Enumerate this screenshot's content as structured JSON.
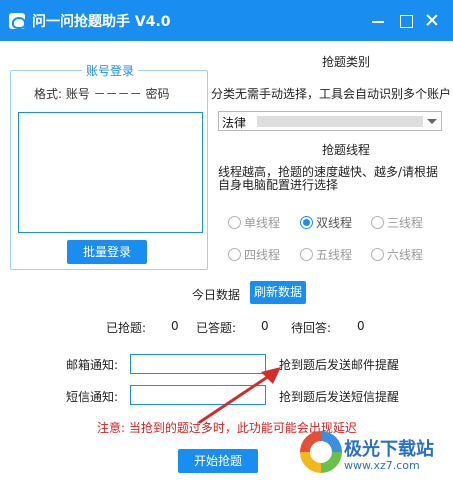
{
  "window": {
    "title": "问一问抢题助手 V4.0",
    "icon": "app-icon"
  },
  "account": {
    "group_title": "账号登录",
    "format_label": "格式: 账号 －－－－ 密码",
    "textarea_value": "",
    "batch_login_label": "批量登录"
  },
  "category": {
    "title": "抢题类别",
    "description": "分类无需手动选择，工具会自动识别多个账户",
    "selected": "法律"
  },
  "threads": {
    "title": "抢题线程",
    "description": "线程越高，抢题的速度越快、越多/请根据自身电脑配置进行选择",
    "options": [
      {
        "label": "单线程",
        "checked": false
      },
      {
        "label": "双线程",
        "checked": true
      },
      {
        "label": "三线程",
        "checked": false
      },
      {
        "label": "四线程",
        "checked": false
      },
      {
        "label": "五线程",
        "checked": false
      },
      {
        "label": "六线程",
        "checked": false
      }
    ]
  },
  "today": {
    "label": "今日数据",
    "refresh_label": "刷新数据"
  },
  "stats": {
    "grabbed_label": "已抢题:",
    "grabbed_value": "0",
    "answered_label": "已答题:",
    "answered_value": "0",
    "pending_label": "待回答:",
    "pending_value": "0"
  },
  "notify": {
    "email_label": "邮箱通知:",
    "email_value": "",
    "email_hint": "抢到题后发送邮件提醒",
    "sms_label": "短信通知:",
    "sms_value": "",
    "sms_hint": "抢到题后发送短信提醒"
  },
  "warning": "注意: 当抢到的题过多时，此功能可能会出现延迟",
  "start_label": "开始抢题",
  "watermark": {
    "name": "极光下载站",
    "url": "www.xz7.com"
  },
  "colors": {
    "accent": "#1a8ef0",
    "warning": "#d81e1e",
    "annotation_arrow": "#d42b2b"
  }
}
